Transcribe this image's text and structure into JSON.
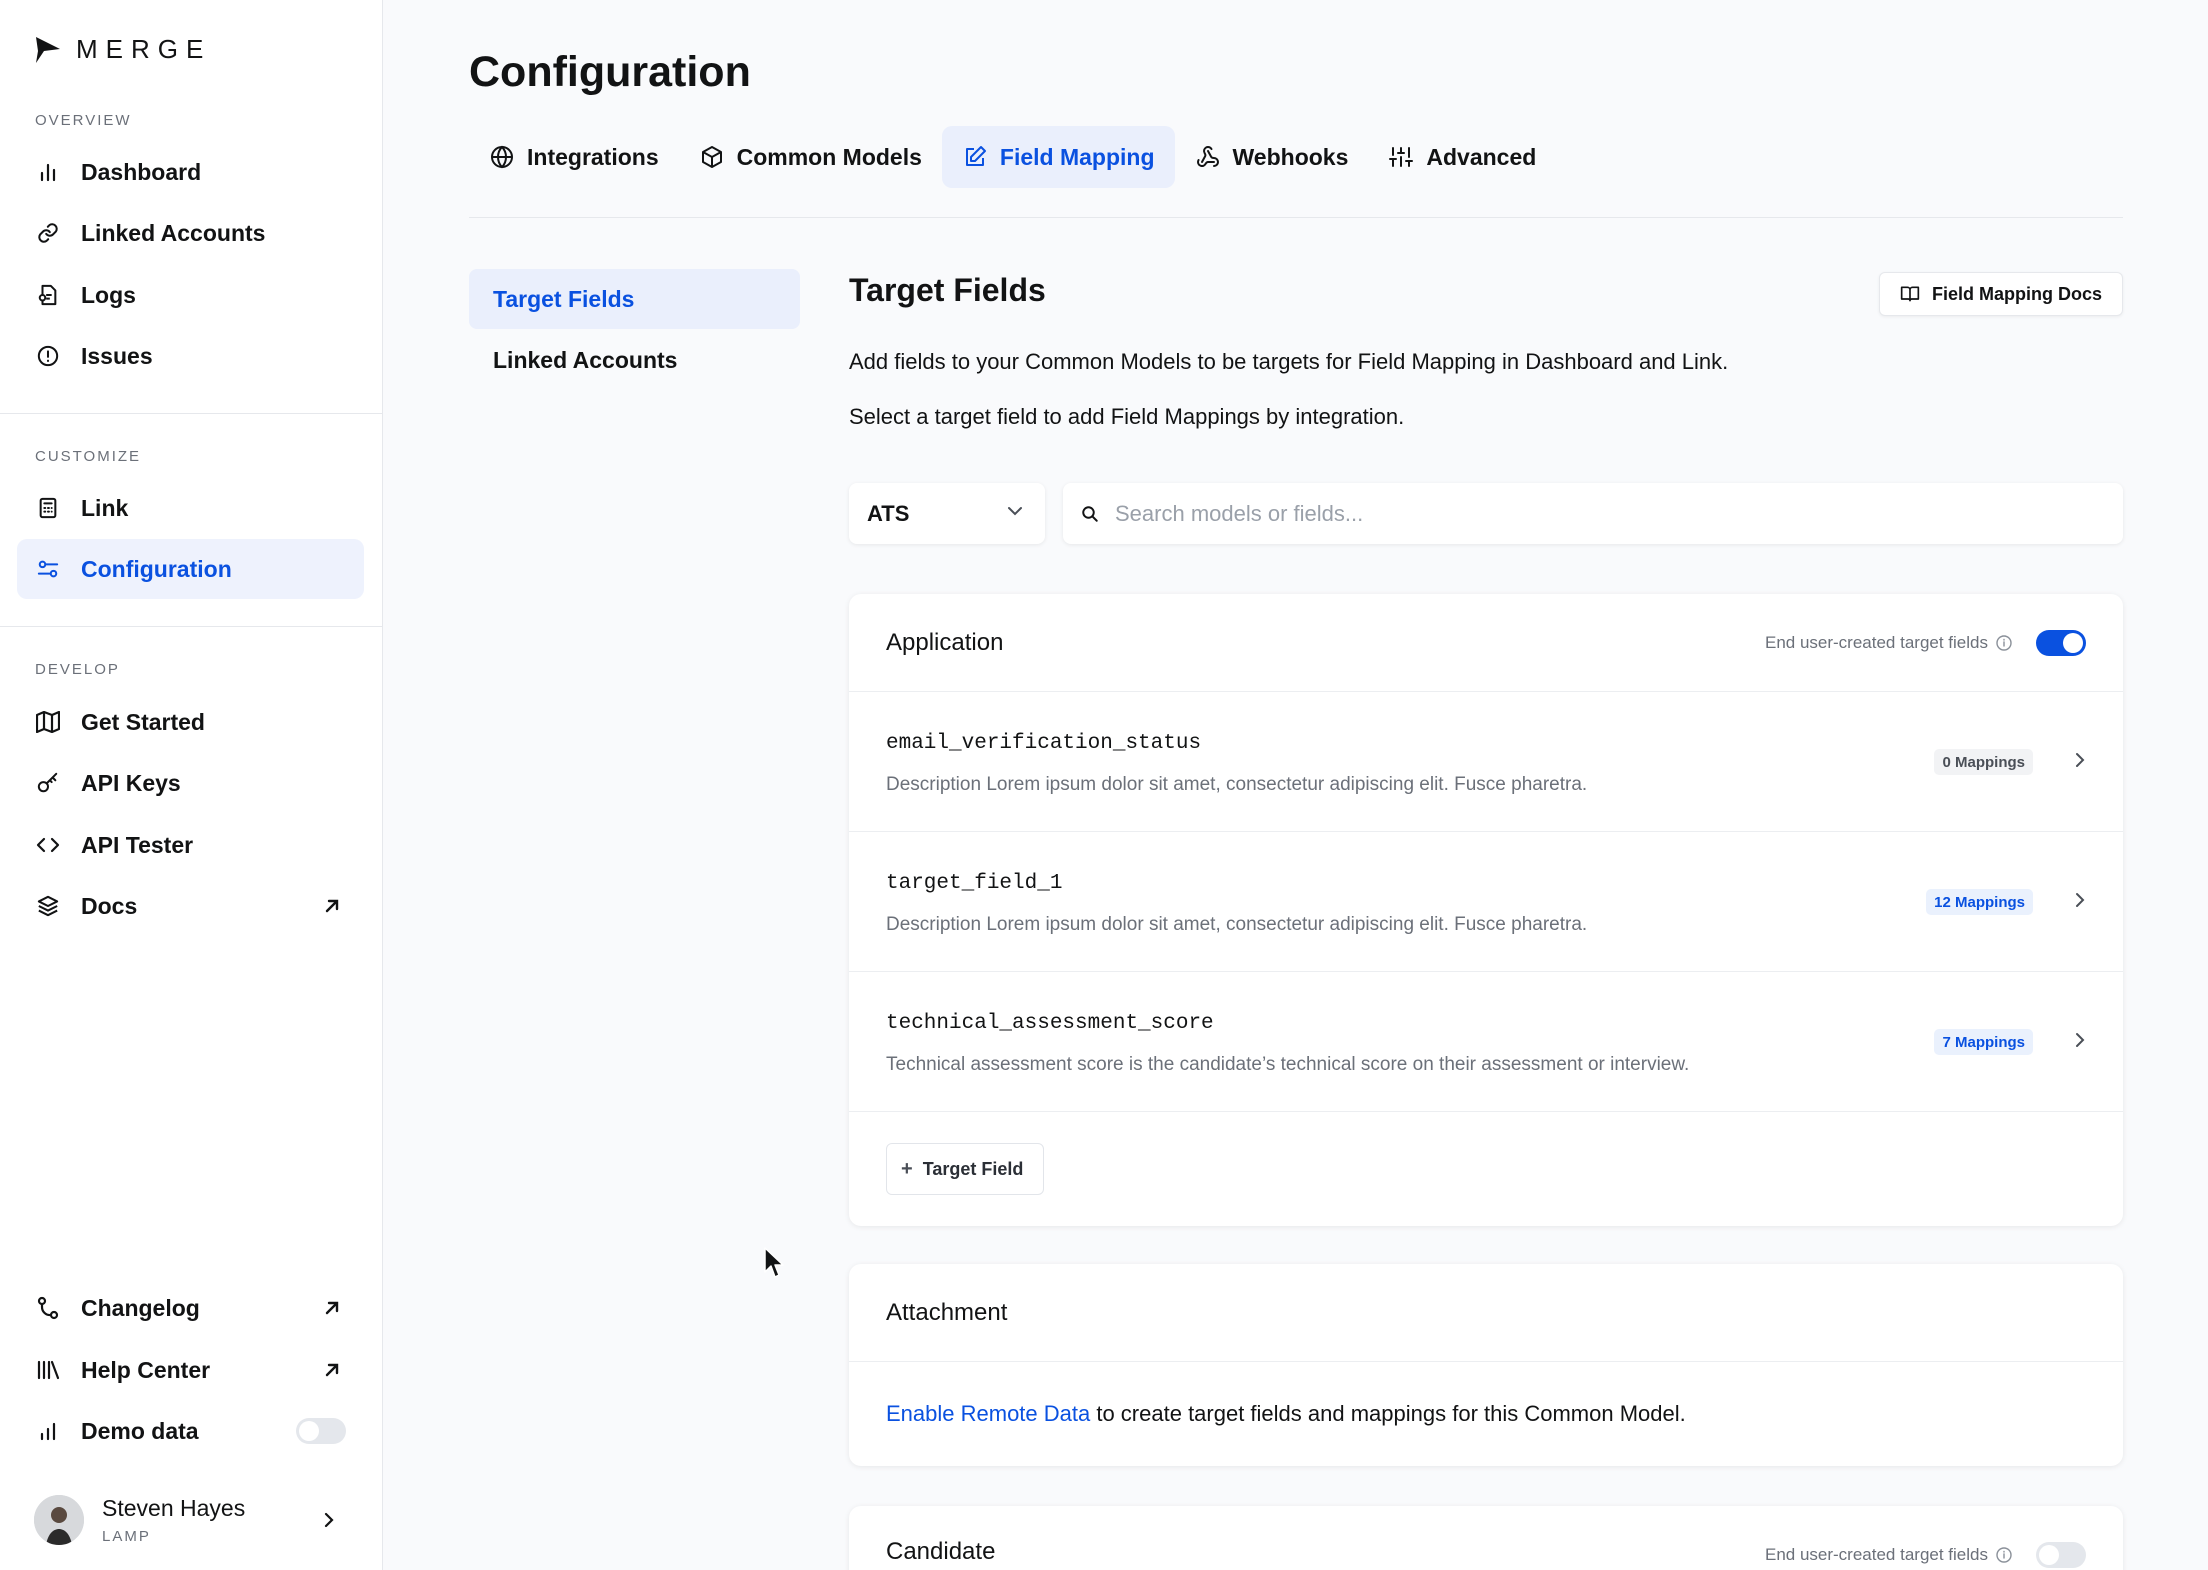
{
  "brand": {
    "name": "MERGE"
  },
  "sidebar": {
    "sections": [
      {
        "label": "OVERVIEW",
        "items": [
          {
            "label": "Dashboard",
            "icon": "bar-chart-icon"
          },
          {
            "label": "Linked Accounts",
            "icon": "link-icon"
          },
          {
            "label": "Logs",
            "icon": "logs-icon"
          },
          {
            "label": "Issues",
            "icon": "alert-circle-icon"
          }
        ]
      },
      {
        "label": "CUSTOMIZE",
        "items": [
          {
            "label": "Link",
            "icon": "calculator-icon"
          },
          {
            "label": "Configuration",
            "icon": "sliders-icon",
            "active": true
          }
        ]
      },
      {
        "label": "DEVELOP",
        "items": [
          {
            "label": "Get Started",
            "icon": "map-icon"
          },
          {
            "label": "API Keys",
            "icon": "key-icon"
          },
          {
            "label": "API Tester",
            "icon": "code-icon"
          },
          {
            "label": "Docs",
            "icon": "layers-icon",
            "external": true
          }
        ]
      }
    ],
    "bottom": [
      {
        "label": "Changelog",
        "icon": "git-icon",
        "external": true
      },
      {
        "label": "Help Center",
        "icon": "library-icon",
        "external": true
      },
      {
        "label": "Demo data",
        "icon": "bar-chart-icon",
        "toggle": false
      }
    ],
    "user": {
      "name": "Steven Hayes",
      "org": "LAMP"
    }
  },
  "page": {
    "title": "Configuration",
    "tabs": [
      {
        "label": "Integrations",
        "icon": "globe-icon"
      },
      {
        "label": "Common Models",
        "icon": "cube-icon"
      },
      {
        "label": "Field Mapping",
        "icon": "edit-icon",
        "active": true
      },
      {
        "label": "Webhooks",
        "icon": "webhook-icon"
      },
      {
        "label": "Advanced",
        "icon": "sliders-vertical-icon"
      }
    ],
    "subnav": [
      {
        "label": "Target Fields",
        "active": true
      },
      {
        "label": "Linked Accounts"
      }
    ]
  },
  "target_fields": {
    "title": "Target Fields",
    "docs_button": "Field Mapping Docs",
    "description_1": "Add fields to your Common Models to be targets for Field Mapping in Dashboard and Link.",
    "description_2": "Select a target field to add Field Mappings by integration.",
    "category_select": "ATS",
    "search_placeholder": "Search models or fields...",
    "models": [
      {
        "title": "Application",
        "option_label": "End user-created target fields",
        "option_enabled": true,
        "fields": [
          {
            "name": "email_verification_status",
            "description": "Description Lorem ipsum dolor sit amet, consectetur adipiscing elit. Fusce pharetra.",
            "mappings": "0 Mappings",
            "mapping_count": 0
          },
          {
            "name": "target_field_1",
            "description": "Description Lorem ipsum dolor sit amet, consectetur adipiscing elit. Fusce pharetra.",
            "mappings": "12 Mappings",
            "mapping_count": 12
          },
          {
            "name": "technical_assessment_score",
            "description": "Technical assessment score is the candidate’s technical score on their assessment or interview.",
            "mappings": "7 Mappings",
            "mapping_count": 7
          }
        ],
        "add_button": "Target Field"
      },
      {
        "title": "Attachment",
        "info_link": "Enable Remote Data",
        "info_text": " to create target fields and mappings for this Common Model."
      },
      {
        "title": "Candidate",
        "option_label": "End user-created target fields",
        "option_enabled": false
      }
    ]
  },
  "colors": {
    "accent": "#0a51e0",
    "active_bg": "#eaeffc",
    "page_bg": "#f9fafc"
  }
}
